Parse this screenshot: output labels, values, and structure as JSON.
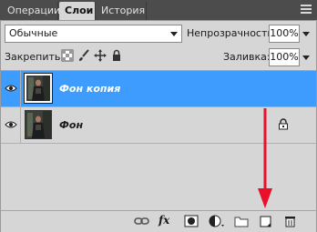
{
  "tabs": [
    {
      "label": "Операции"
    },
    {
      "label": "Слои"
    },
    {
      "label": "История"
    }
  ],
  "blend_mode": {
    "value": "Обычные"
  },
  "opacity": {
    "label": "Непрозрачность:",
    "value": "100%"
  },
  "lock": {
    "label": "Закрепить:"
  },
  "fill": {
    "label": "Заливка:",
    "value": "100%"
  },
  "layers": [
    {
      "name": "Фон копия",
      "selected": true,
      "locked": false,
      "visible": true
    },
    {
      "name": "Фон",
      "selected": false,
      "locked": true,
      "visible": true
    }
  ],
  "toolbar": {
    "fx_label": "fx"
  },
  "colors": {
    "selection": "#3d9cfe",
    "panel_bg": "#d6d6d6",
    "tabbar_bg": "#4c4c4c",
    "annotation_arrow": "#e8102a"
  },
  "icons": [
    "eye-icon",
    "link-icon",
    "fx-icon",
    "mask-icon",
    "adjustment-icon",
    "folder-icon",
    "new-layer-icon",
    "trash-icon",
    "lock-icon",
    "brush-icon",
    "move-icon",
    "transparency-lock-icon"
  ]
}
